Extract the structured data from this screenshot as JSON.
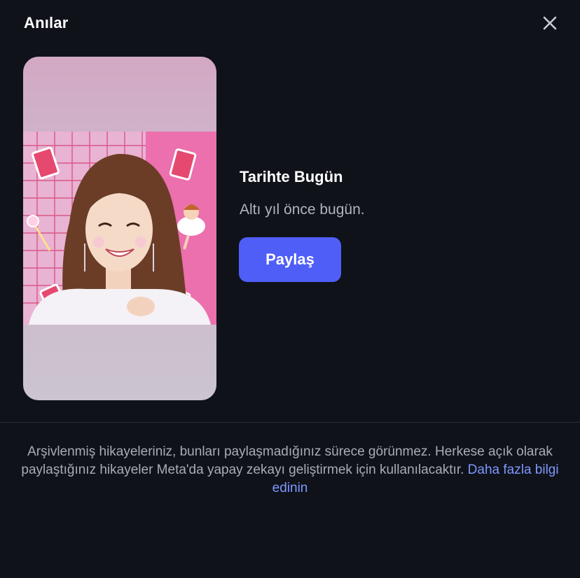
{
  "header": {
    "title": "Anılar",
    "close_icon": "close-icon"
  },
  "memory": {
    "heading": "Tarihte Bugün",
    "subtitle": "Altı yıl önce bugün.",
    "share_label": "Paylaş",
    "accent": "#4f5ef7"
  },
  "footer": {
    "notice_text": "Arşivlenmiş hikayeleriniz, bunları paylaşmadığınız sürece görünmez. Herkese açık olarak paylaştığınız hikayeler Meta'da yapay zekayı geliştirmek için kullanılacaktır.",
    "link_text": "Daha fazla bilgi edinin",
    "link_color": "#7e98ff"
  }
}
